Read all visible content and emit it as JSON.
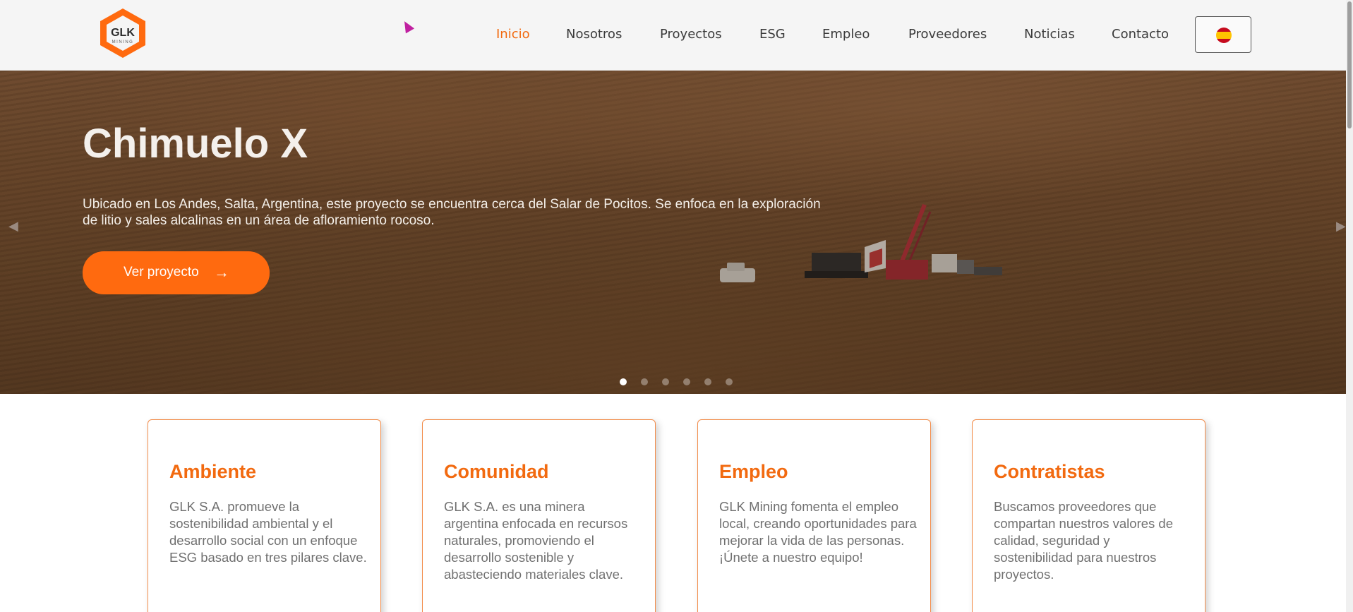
{
  "header": {
    "logo_text": "GLK",
    "logo_subtext": "MINING",
    "nav": [
      {
        "label": "Inicio",
        "active": true
      },
      {
        "label": "Nosotros"
      },
      {
        "label": "Proyectos"
      },
      {
        "label": "ESG"
      },
      {
        "label": "Empleo"
      },
      {
        "label": "Proveedores"
      },
      {
        "label": "Noticias"
      },
      {
        "label": "Contacto"
      }
    ],
    "language_flag": "spain-flag-icon"
  },
  "hero": {
    "title": "Chimuelo X",
    "description": "Ubicado en Los Andes, Salta, Argentina, este proyecto se encuentra cerca del Salar de Pocitos. Se enfoca en la exploración de litio y sales alcalinas en un área de afloramiento rocoso.",
    "button_label": "Ver proyecto",
    "button_icon": "→",
    "prev_icon": "◀",
    "next_icon": "▶",
    "slide_count": 6,
    "active_slide": 1
  },
  "cards": [
    {
      "title": "Ambiente",
      "text": "GLK S.A. promueve la sostenibilidad ambiental y el desarrollo social con un enfoque ESG basado en tres pilares clave."
    },
    {
      "title": "Comunidad",
      "text": "GLK S.A. es una minera argentina enfocada en recursos naturales, promoviendo el desarrollo sostenible y abasteciendo materiales clave."
    },
    {
      "title": "Empleo",
      "text": "GLK Mining fomenta el empleo local, creando oportunidades para mejorar la vida de las personas. ¡Únete a nuestro equipo!"
    },
    {
      "title": "Contratistas",
      "text": "Buscamos proveedores que compartan nuestros valores de calidad, seguridad y sostenibilidad para nuestros proyectos."
    }
  ],
  "colors": {
    "accent": "#f26a10",
    "button": "#ff6a0f"
  }
}
